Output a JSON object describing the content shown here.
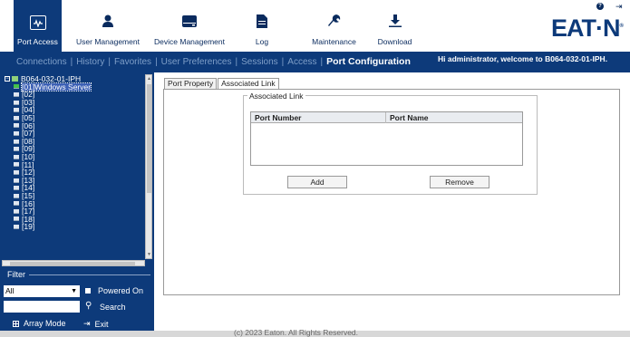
{
  "toolbar": {
    "items": [
      {
        "label": "Port Access",
        "icon": "monitor-icon"
      },
      {
        "label": "User Management",
        "icon": "user-icon"
      },
      {
        "label": "Device Management",
        "icon": "device-icon"
      },
      {
        "label": "Log",
        "icon": "document-icon"
      },
      {
        "label": "Maintenance",
        "icon": "wrench-icon"
      },
      {
        "label": "Download",
        "icon": "download-icon"
      }
    ],
    "logo_text": "EAT·N",
    "logo_reg": "®"
  },
  "nav": {
    "links": [
      "Connections",
      "History",
      "Favorites",
      "User Preferences",
      "Sessions",
      "Access"
    ],
    "current": "Port Configuration",
    "welcome": "Hi administrator, welcome to B064-032-01-IPH."
  },
  "tree": {
    "root": "B064-032-01-IPH",
    "selected": "[01]Windows Server",
    "ports": [
      "[02]",
      "[03]",
      "[04]",
      "[05]",
      "[06]",
      "[07]",
      "[08]",
      "[09]",
      "[10]",
      "[11]",
      "[12]",
      "[13]",
      "[14]",
      "[15]",
      "[16]",
      "[17]",
      "[18]",
      "[19]"
    ]
  },
  "filter": {
    "label": "Filter",
    "select_value": "All",
    "powered_on_label": "Powered On",
    "search_label": "Search"
  },
  "bottom": {
    "array_mode": "Array Mode",
    "exit": "Exit"
  },
  "main": {
    "tabs": [
      "Port Property",
      "Associated Link"
    ],
    "fieldset_legend": "Associated Link",
    "columns": [
      "Port Number",
      "Port Name"
    ],
    "add_label": "Add",
    "remove_label": "Remove"
  },
  "footer": "(c) 2023 Eaton. All Rights Reserved.",
  "colors": {
    "brand_navy": "#0d3a7a",
    "selected_green": "#43c04a"
  }
}
